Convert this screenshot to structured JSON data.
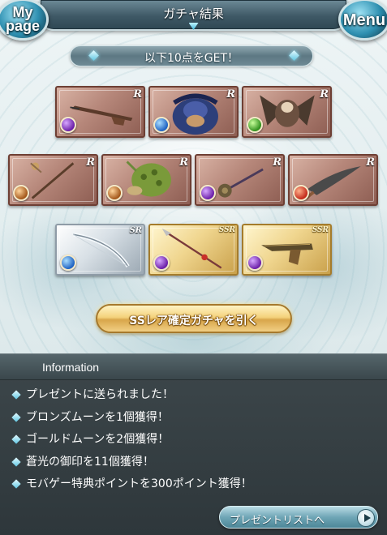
{
  "header": {
    "title": "ガチャ結果",
    "mypage_label": "My page",
    "menu_label": "Menu"
  },
  "result": {
    "banner": "以下10点をGET！"
  },
  "cards": [
    {
      "rarity": "R",
      "element": "dark",
      "item": "rifle"
    },
    {
      "rarity": "R",
      "element": "water",
      "item": "beast"
    },
    {
      "rarity": "R",
      "element": "wind",
      "item": "winged-beast"
    },
    {
      "rarity": "R",
      "element": "earth",
      "item": "staff"
    },
    {
      "rarity": "R",
      "element": "earth",
      "item": "turtle"
    },
    {
      "rarity": "R",
      "element": "dark",
      "item": "mace"
    },
    {
      "rarity": "R",
      "element": "fire",
      "item": "sword"
    },
    {
      "rarity": "SR",
      "element": "water",
      "item": "bow"
    },
    {
      "rarity": "SSR",
      "element": "dark",
      "item": "spear"
    },
    {
      "rarity": "SSR",
      "element": "dark",
      "item": "pistol"
    }
  ],
  "gacha_button": {
    "label": "SSレア確定ガチャを引く"
  },
  "information": {
    "title": "Information",
    "items": [
      "プレゼントに送られました！",
      "ブロンズムーンを1個獲得！",
      "ゴールドムーンを2個獲得！",
      "蒼光の御印を11個獲得！",
      "モバゲー特典ポイントを300ポイント獲得！"
    ],
    "present_button": "プレゼントリストへ"
  },
  "colors": {
    "rare_frame": "#b6877a",
    "sr_frame": "#d8e0e6",
    "ssr_frame": "#f0d68f",
    "accent": "#5fc7e3"
  }
}
